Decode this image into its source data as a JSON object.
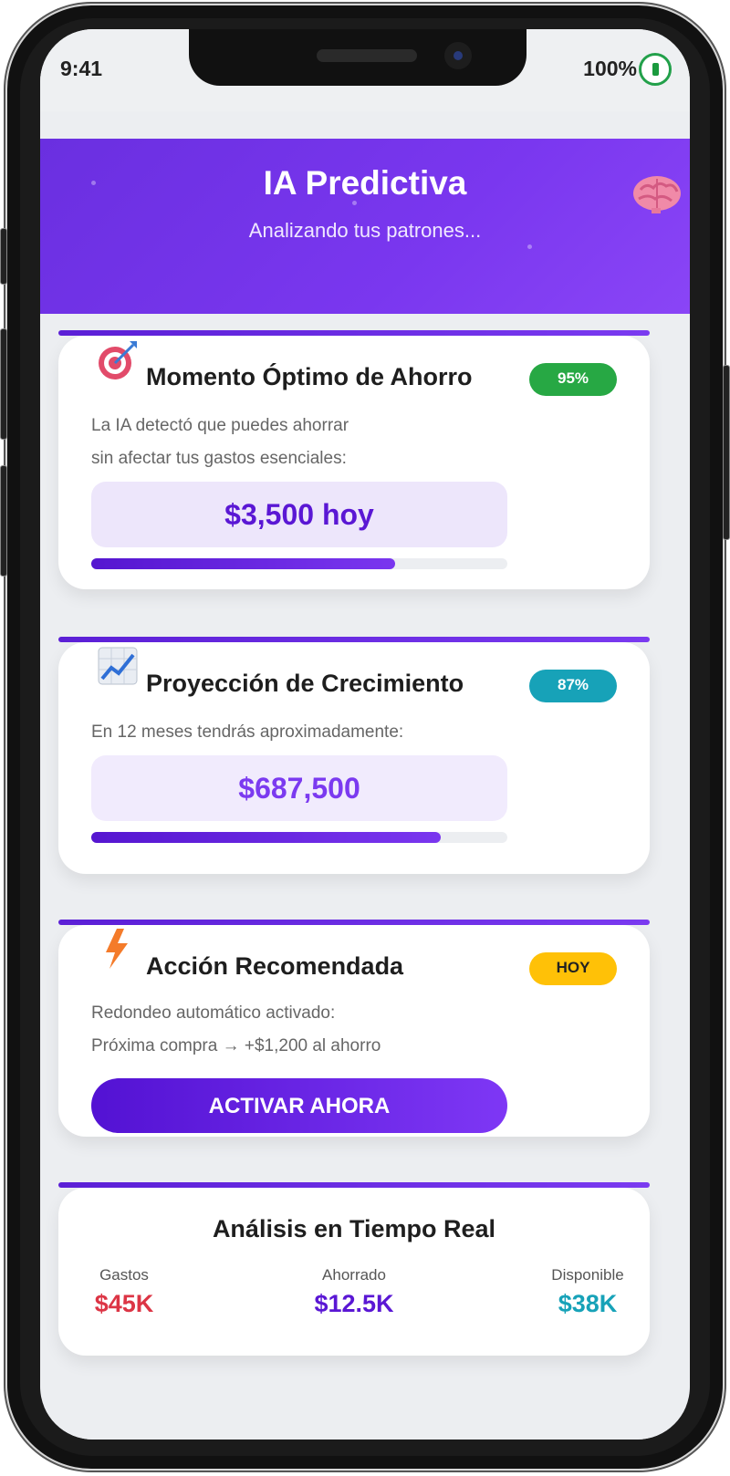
{
  "status_bar": {
    "time": "9:41",
    "battery": "100%"
  },
  "header": {
    "title": "IA Predictiva",
    "subtitle": "Analizando tus patrones..."
  },
  "cards": [
    {
      "icon": "target-icon",
      "title": "Momento Óptimo de Ahorro",
      "badge": "95%",
      "badge_color": "#27a844",
      "description_lines": [
        "La IA detectó que puedes ahorrar",
        "sin afectar tus gastos esenciales:"
      ],
      "value": "$3,500 hoy",
      "value_color": "#5a17d4",
      "progress": 0.73
    },
    {
      "icon": "chart-increasing-icon",
      "title": "Proyección de Crecimiento",
      "badge": "87%",
      "badge_color": "#17a2b8",
      "description_lines": [
        "En 12 meses tendrás aproximadamente:"
      ],
      "value": "$687,500",
      "value_color": "#7b3af0",
      "progress": 0.84
    },
    {
      "icon": "lightning-icon",
      "title": "Acción Recomendada",
      "badge": "HOY",
      "badge_color": "#ffc107",
      "description_lines": [
        "Redondeo automático activado:",
        "Próxima compra → +$1,200 al ahorro"
      ],
      "button_label": "ACTIVAR AHORA"
    }
  ],
  "realtime": {
    "title": "Análisis en Tiempo Real",
    "stats": [
      {
        "label": "Gastos",
        "value": "$45K",
        "color": "#dc3545"
      },
      {
        "label": "Ahorrado",
        "value": "$12.5K",
        "color": "#5a17d4"
      },
      {
        "label": "Disponible",
        "value": "$38K",
        "color": "#17a2b8"
      }
    ]
  }
}
